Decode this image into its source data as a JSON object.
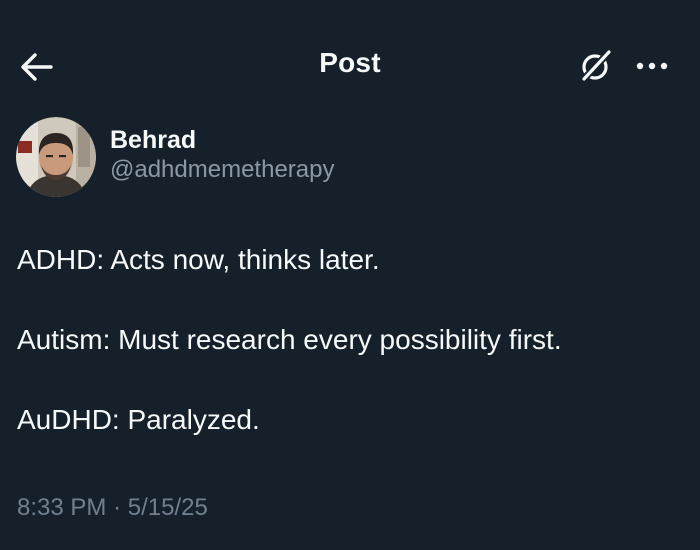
{
  "header": {
    "title": "Post",
    "back_icon": "arrow-left-icon",
    "grok_icon": "grok-icon",
    "more_icon": "ellipsis-icon"
  },
  "author": {
    "display_name": "Behrad",
    "handle": "@adhdmemetherapy"
  },
  "post": {
    "lines": [
      "ADHD: Acts now, thinks later.",
      "Autism: Must research every possibility first.",
      "AuDHD: Paralyzed."
    ]
  },
  "meta": {
    "time": "8:33 PM",
    "separator": "·",
    "date": "5/15/25"
  },
  "colors": {
    "background": "#15202b",
    "text_primary": "#f7f9f9",
    "text_secondary": "#8b98a5"
  }
}
